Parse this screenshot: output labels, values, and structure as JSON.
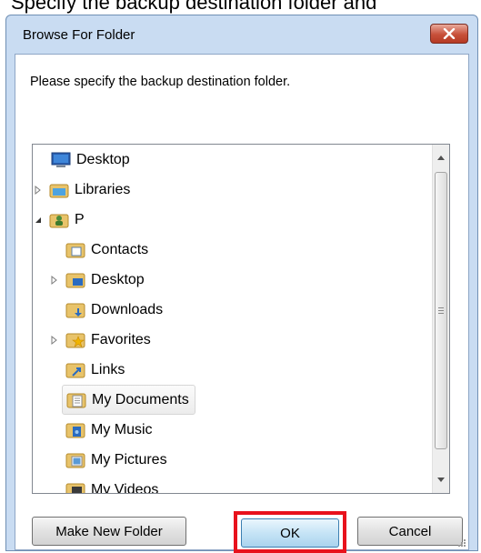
{
  "instruction": {
    "text": "Specify the backup destination folder and"
  },
  "dialog": {
    "title": "Browse For Folder",
    "prompt": "Please specify the backup destination folder.",
    "tree": [
      {
        "label": "Desktop",
        "icon": "desktop-icon",
        "expander": "none"
      },
      {
        "label": "Libraries",
        "icon": "libraries-icon",
        "expander": "collapsed"
      },
      {
        "label": "P",
        "icon": "user-folder-icon",
        "expander": "expanded"
      },
      {
        "label": "Contacts",
        "icon": "contacts-folder-icon",
        "expander": "none"
      },
      {
        "label": "Desktop",
        "icon": "desktop-folder-icon",
        "expander": "collapsed"
      },
      {
        "label": "Downloads",
        "icon": "downloads-folder-icon",
        "expander": "none"
      },
      {
        "label": "Favorites",
        "icon": "favorites-folder-icon",
        "expander": "collapsed"
      },
      {
        "label": "Links",
        "icon": "links-folder-icon",
        "expander": "none"
      },
      {
        "label": "My Documents",
        "icon": "documents-folder-icon",
        "expander": "none",
        "selected": true
      },
      {
        "label": "My Music",
        "icon": "music-folder-icon",
        "expander": "none"
      },
      {
        "label": "My Pictures",
        "icon": "pictures-folder-icon",
        "expander": "none"
      },
      {
        "label": "My Videos",
        "icon": "videos-folder-icon",
        "expander": "none"
      }
    ],
    "buttons": {
      "make_new_folder": "Make New Folder",
      "ok": "OK",
      "cancel": "Cancel"
    },
    "colors": {
      "highlight": "#e8121c",
      "titlebar": "#c9dcf2",
      "ok_border": "#3c7fb1"
    }
  }
}
